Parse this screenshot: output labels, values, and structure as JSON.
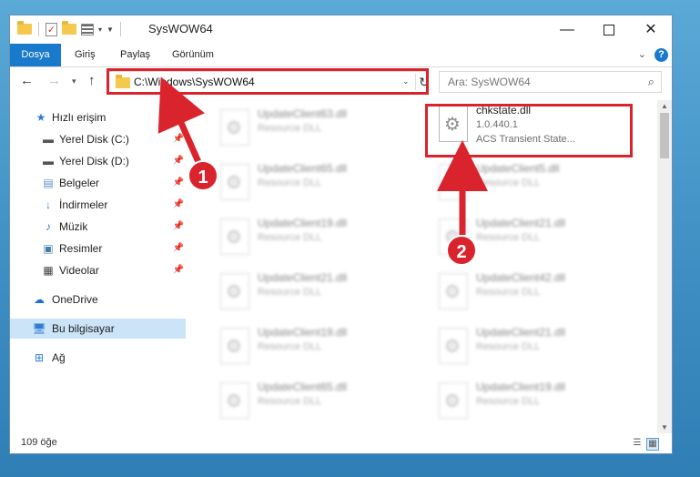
{
  "window": {
    "title": "SysWOW64"
  },
  "ribbon": {
    "tabs": [
      {
        "label": "Dosya",
        "active": true
      },
      {
        "label": "Giriş"
      },
      {
        "label": "Paylaş"
      },
      {
        "label": "Görünüm"
      }
    ],
    "help_label": "?"
  },
  "address": {
    "path": "C:\\Windows\\SysWOW64",
    "search_placeholder": "Ara: SysWOW64"
  },
  "sidebar": {
    "items": [
      {
        "label": "Hızlı erişim",
        "icon": "star-icon",
        "pinned": false
      },
      {
        "label": "Yerel Disk (C:)",
        "icon": "drive-icon",
        "pinned": true
      },
      {
        "label": "Yerel Disk (D:)",
        "icon": "drive-icon",
        "pinned": true
      },
      {
        "label": "Belgeler",
        "icon": "documents-icon",
        "pinned": true
      },
      {
        "label": "İndirmeler",
        "icon": "download-icon",
        "pinned": true
      },
      {
        "label": "Müzik",
        "icon": "music-icon",
        "pinned": true
      },
      {
        "label": "Resimler",
        "icon": "pictures-icon",
        "pinned": true
      },
      {
        "label": "Videolar",
        "icon": "video-icon",
        "pinned": true
      },
      {
        "label": "OneDrive",
        "icon": "cloud-icon",
        "pinned": false
      },
      {
        "label": "Bu bilgisayar",
        "icon": "computer-icon",
        "pinned": false,
        "selected": true
      },
      {
        "label": "Ağ",
        "icon": "network-icon",
        "pinned": false
      }
    ]
  },
  "files": {
    "left_column": [
      {
        "name": "UpdateClient63.dll",
        "type": "Resource DLL"
      },
      {
        "name": "UpdateClient65.dll",
        "type": "Resource DLL"
      },
      {
        "name": "UpdateClient19.dll",
        "type": "Resource DLL"
      },
      {
        "name": "UpdateClient21.dll",
        "type": "Resource DLL"
      },
      {
        "name": "UpdateClient19.dll",
        "type": "Resource DLL"
      },
      {
        "name": "UpdateClient65.dll",
        "type": "Resource DLL"
      }
    ],
    "highlighted": {
      "name": "chkstate.dll",
      "version": "1.0.440.1",
      "description": "ACS Transient State..."
    },
    "right_column": [
      {
        "name": "UpdateClient5.dll",
        "type": "Resource DLL"
      },
      {
        "name": "UpdateClient21.dll",
        "type": "Resource DLL"
      },
      {
        "name": "UpdateClient42.dll",
        "type": "Resource DLL"
      },
      {
        "name": "UpdateClient21.dll",
        "type": "Resource DLL"
      },
      {
        "name": "UpdateClient19.dll",
        "type": "Resource DLL"
      }
    ]
  },
  "status": {
    "item_count": "109 öğe"
  },
  "annotations": {
    "step1": "1",
    "step2": "2",
    "highlight_color": "#d9232d"
  }
}
